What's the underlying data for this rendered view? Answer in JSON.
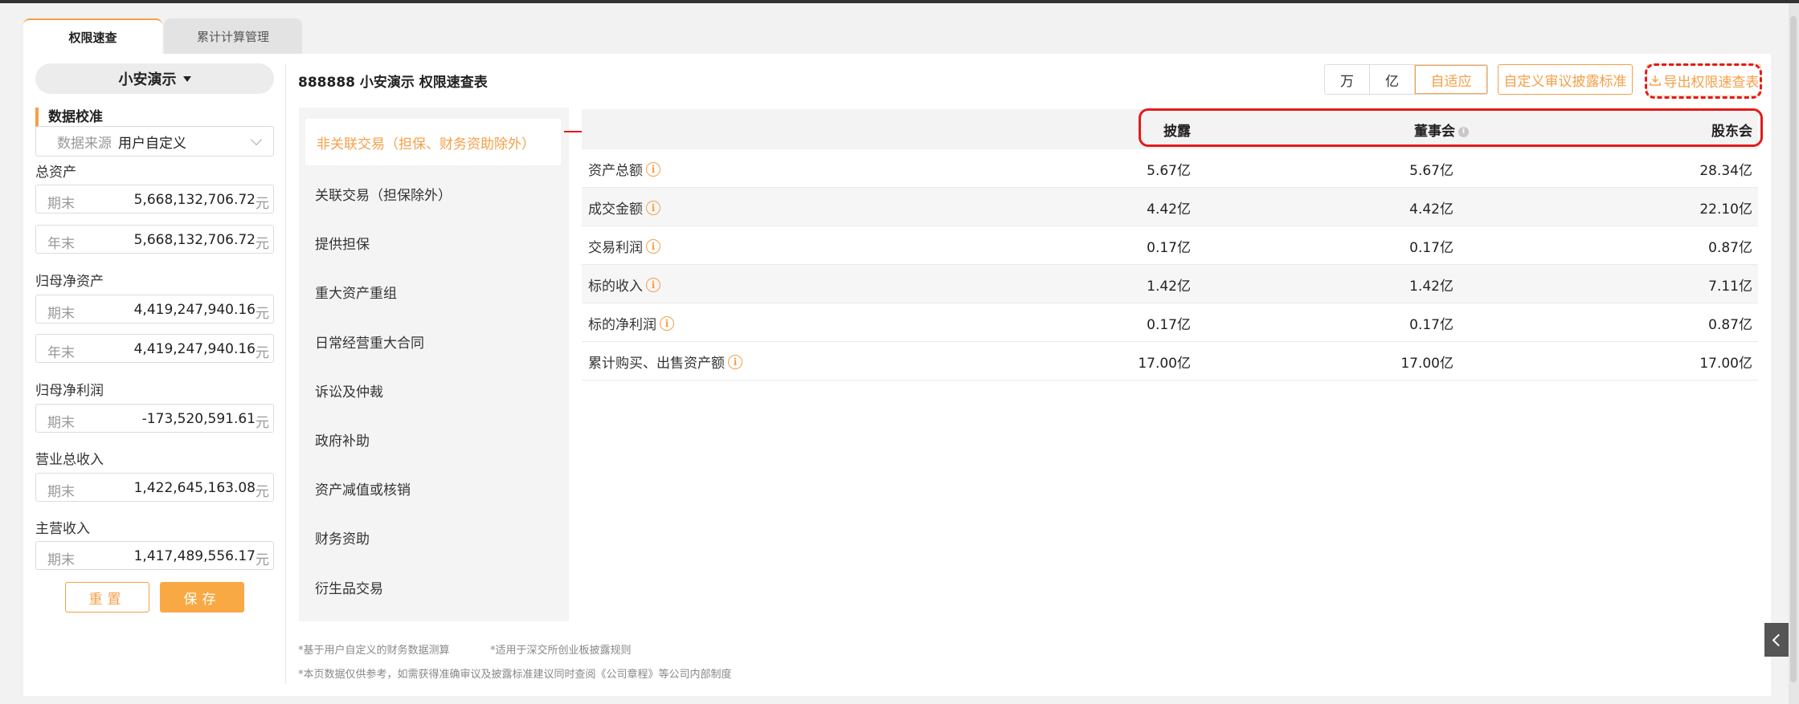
{
  "tabs": [
    {
      "label": "权限速查"
    },
    {
      "label": "累计计算管理"
    }
  ],
  "sidebar": {
    "company": "小安演示",
    "section_title": "数据校准",
    "data_source": {
      "label": "数据来源",
      "value": "用户自定义"
    },
    "groups": [
      {
        "label": "总资产",
        "fields": [
          {
            "key": "期末",
            "value": "5,668,132,706.72",
            "unit": "元"
          },
          {
            "key": "年末",
            "value": "5,668,132,706.72",
            "unit": "元"
          }
        ]
      },
      {
        "label": "归母净资产",
        "fields": [
          {
            "key": "期末",
            "value": "4,419,247,940.16",
            "unit": "元"
          },
          {
            "key": "年末",
            "value": "4,419,247,940.16",
            "unit": "元"
          }
        ]
      },
      {
        "label": "归母净利润",
        "fields": [
          {
            "key": "期末",
            "value": "-173,520,591.61",
            "unit": "元"
          }
        ]
      },
      {
        "label": "营业总收入",
        "fields": [
          {
            "key": "期末",
            "value": "1,422,645,163.08",
            "unit": "元"
          }
        ]
      },
      {
        "label": "主营收入",
        "fields": [
          {
            "key": "期末",
            "value": "1,417,489,556.17",
            "unit": "元"
          }
        ]
      }
    ],
    "reset_label": "重置",
    "save_label": "保存"
  },
  "header": {
    "title": "888888 小安演示 权限速查表",
    "units": [
      "万",
      "亿",
      "自适应"
    ],
    "active_unit": "自适应",
    "standard_label": "自定义审议披露标准",
    "export_label": "导出权限速查表"
  },
  "categories": [
    "非关联交易（担保、财务资助除外）",
    "关联交易（担保除外）",
    "提供担保",
    "重大资产重组",
    "日常经营重大合同",
    "诉讼及仲裁",
    "政府补助",
    "资产减值或核销",
    "财务资助",
    "衍生品交易"
  ],
  "table": {
    "columns": [
      "披露",
      "董事会",
      "股东会"
    ],
    "rows": [
      {
        "name": "资产总额",
        "values": [
          "5.67亿",
          "5.67亿",
          "28.34亿"
        ]
      },
      {
        "name": "成交金额",
        "values": [
          "4.42亿",
          "4.42亿",
          "22.10亿"
        ]
      },
      {
        "name": "交易利润",
        "values": [
          "0.17亿",
          "0.17亿",
          "0.87亿"
        ]
      },
      {
        "name": "标的收入",
        "values": [
          "1.42亿",
          "1.42亿",
          "7.11亿"
        ]
      },
      {
        "name": "标的净利润",
        "values": [
          "0.17亿",
          "0.17亿",
          "0.87亿"
        ]
      },
      {
        "name": "累计购买、出售资产额",
        "values": [
          "17.00亿",
          "17.00亿",
          "17.00亿"
        ]
      }
    ]
  },
  "footnotes": [
    "*基于用户自定义的财务数据测算",
    "*适用于深交所创业板披露规则",
    "*本页数据仅供参考，如需获得准确审议及披露标准建议同时查阅《公司章程》等公司内部制度"
  ],
  "icons": {
    "info": "info-icon",
    "export": "download-icon",
    "collapse": "chevron-left-icon"
  },
  "colors": {
    "accent": "#f5a048",
    "annotation": "#e31b1b"
  }
}
